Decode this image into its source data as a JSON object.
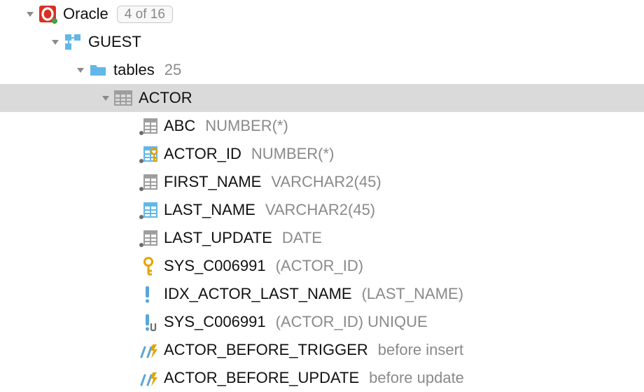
{
  "root": {
    "name": "Oracle",
    "badge": "4 of 16"
  },
  "schema": {
    "name": "GUEST"
  },
  "tablesFolder": {
    "name": "tables",
    "count": "25"
  },
  "table": {
    "name": "ACTOR"
  },
  "children": [
    {
      "icon": "column-dot",
      "name": "ABC",
      "meta": "NUMBER(*)"
    },
    {
      "icon": "column-key",
      "name": "ACTOR_ID",
      "meta": "NUMBER(*)"
    },
    {
      "icon": "column-dot",
      "name": "FIRST_NAME",
      "meta": "VARCHAR2(45)"
    },
    {
      "icon": "column-blue",
      "name": "LAST_NAME",
      "meta": "VARCHAR2(45)"
    },
    {
      "icon": "column-dot",
      "name": "LAST_UPDATE",
      "meta": "DATE"
    },
    {
      "icon": "key",
      "name": "SYS_C006991",
      "meta": "(ACTOR_ID)"
    },
    {
      "icon": "index",
      "name": "IDX_ACTOR_LAST_NAME",
      "meta": "(LAST_NAME)"
    },
    {
      "icon": "index-unique",
      "name": "SYS_C006991",
      "meta": "(ACTOR_ID) UNIQUE"
    },
    {
      "icon": "trigger",
      "name": "ACTOR_BEFORE_TRIGGER",
      "meta": "before insert"
    },
    {
      "icon": "trigger",
      "name": "ACTOR_BEFORE_UPDATE",
      "meta": "before update"
    }
  ]
}
